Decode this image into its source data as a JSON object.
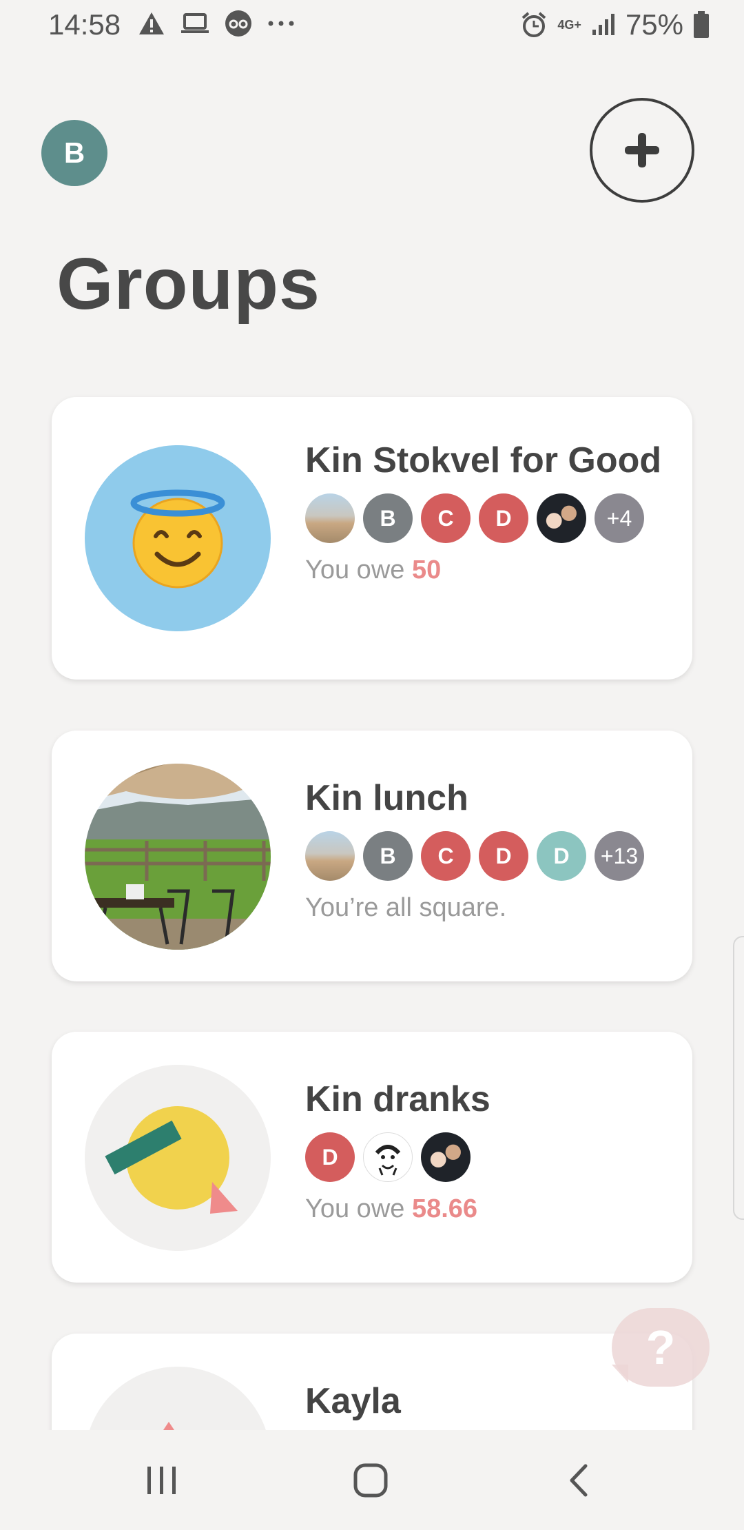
{
  "status_bar": {
    "time": "14:58",
    "left_icons": [
      "alert-icon",
      "laptop-icon",
      "glasses-icon",
      "more-dots-icon"
    ],
    "network": "4G+",
    "battery": "75%"
  },
  "header": {
    "user_initial": "B",
    "title": "Groups"
  },
  "groups": [
    {
      "name": "Kin Stokvel for Good",
      "thumb": "halo-smiley-emoji",
      "members": [
        {
          "type": "photo",
          "name": "beach-photo-avatar"
        },
        {
          "type": "initial",
          "label": "B",
          "color": "#7a7f82"
        },
        {
          "type": "initial",
          "label": "C",
          "color": "#d45d5d"
        },
        {
          "type": "initial",
          "label": "D",
          "color": "#d45d5d"
        },
        {
          "type": "photo",
          "name": "family-photo-avatar"
        }
      ],
      "more_count": "+4",
      "balance_text": "You owe",
      "balance_amount": "50"
    },
    {
      "name": "Kin lunch",
      "thumb": "restaurant-patio-photo",
      "members": [
        {
          "type": "photo",
          "name": "beach-photo-avatar"
        },
        {
          "type": "initial",
          "label": "B",
          "color": "#7a7f82"
        },
        {
          "type": "initial",
          "label": "C",
          "color": "#d45d5d"
        },
        {
          "type": "initial",
          "label": "D",
          "color": "#d45d5d"
        },
        {
          "type": "initial",
          "label": "D",
          "color": "#8cc5c0"
        }
      ],
      "more_count": "+13",
      "balance_text": "You’re all square.",
      "balance_amount": ""
    },
    {
      "name": "Kin dranks",
      "thumb": "abstract-shapes-illustration",
      "members": [
        {
          "type": "initial",
          "label": "D",
          "color": "#d45d5d"
        },
        {
          "type": "photo",
          "name": "sketch-face-avatar"
        },
        {
          "type": "photo",
          "name": "family-photo-avatar"
        }
      ],
      "more_count": "",
      "balance_text": "You owe",
      "balance_amount": "58.66"
    },
    {
      "name": "Kayla",
      "thumb": "triangle-illustration"
    }
  ],
  "help_button": "?",
  "nav": [
    "recent-apps-icon",
    "home-icon",
    "back-icon"
  ],
  "colors": {
    "background": "#f4f3f2",
    "owe_amount": "#ea8a8a",
    "user_avatar": "#5e8e8c",
    "member_red": "#d45d5d"
  }
}
